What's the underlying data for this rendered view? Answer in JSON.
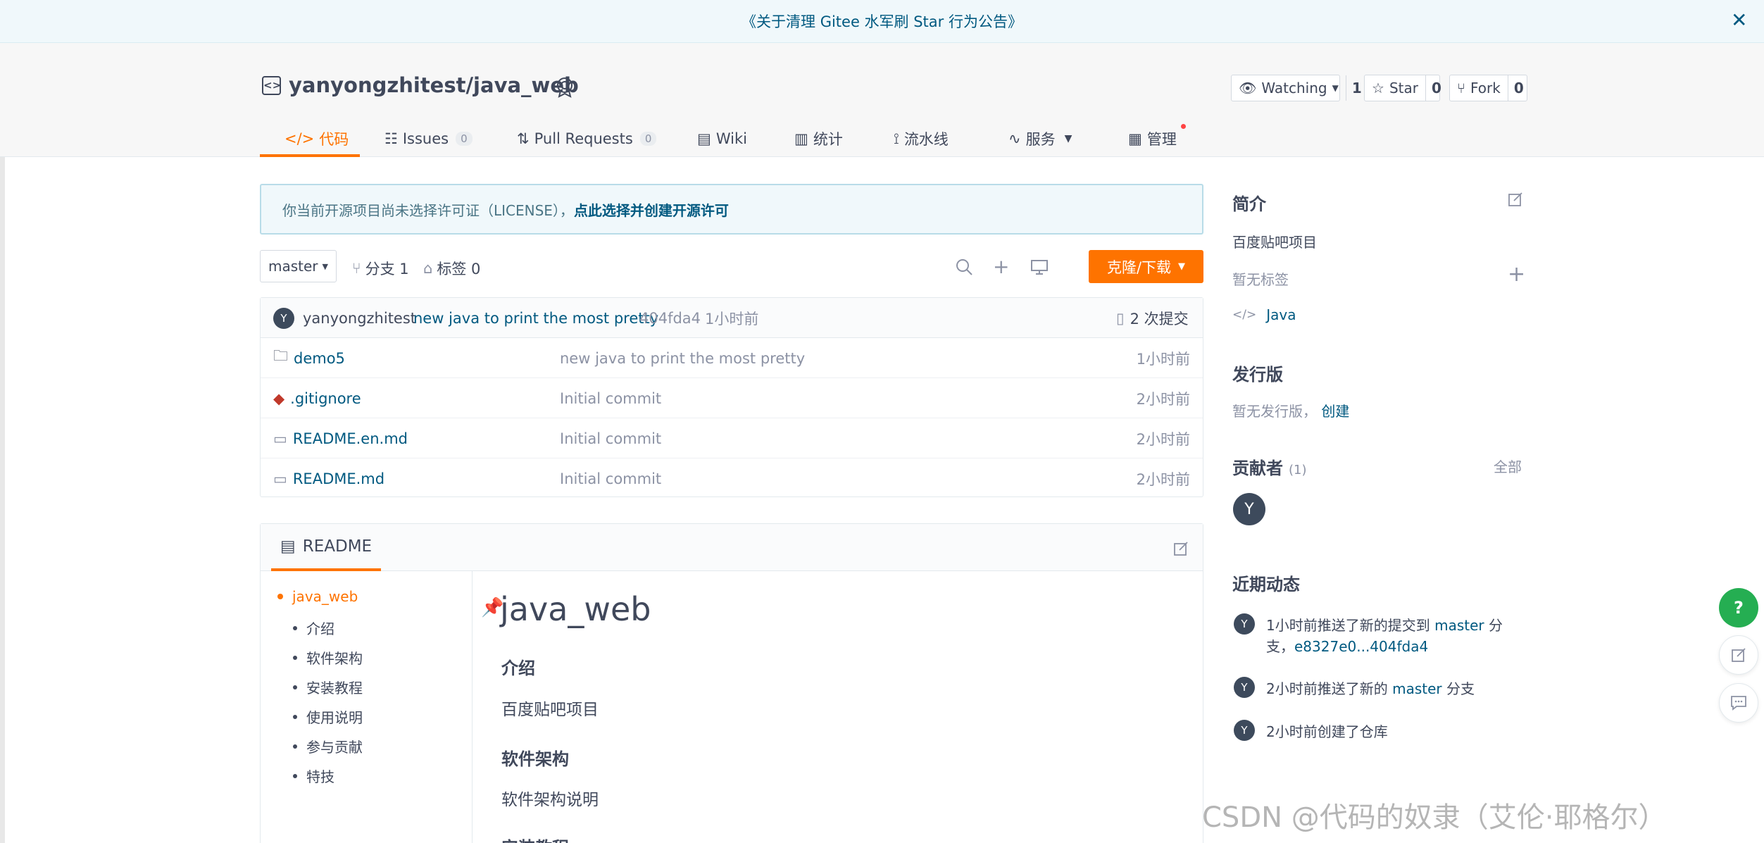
{
  "banner": {
    "text": "《关于清理 Gitee 水军刷 Star 行为公告》",
    "close": "✕"
  },
  "repo": {
    "title": "yanyongzhitest/java_web",
    "watch_label": "Watching",
    "watch_count": "1",
    "star_label": "Star",
    "star_count": "0",
    "fork_label": "Fork",
    "fork_count": "0"
  },
  "tabs": [
    {
      "label": "代码",
      "active": true
    },
    {
      "label": "Issues",
      "count": "0"
    },
    {
      "label": "Pull Requests",
      "count": "0"
    },
    {
      "label": "Wiki"
    },
    {
      "label": "统计"
    },
    {
      "label": "流水线"
    },
    {
      "label": "服务"
    },
    {
      "label": "管理"
    }
  ],
  "license": {
    "text": "你当前开源项目尚未选择许可证（LICENSE），",
    "link": "点此选择并创建开源许可"
  },
  "toolbar": {
    "branch": "master",
    "branches": "分支 1",
    "tags": "标签 0",
    "clone": "克隆/下载"
  },
  "commit": {
    "avatar": "Y",
    "author": "yanyongzhitest",
    "message": "new java to print the most pretty",
    "hash": "404fda4",
    "time": "1小时前",
    "count": "2 次提交"
  },
  "files": [
    {
      "name": "demo5",
      "type": "folder",
      "message": "new java to print the most pretty",
      "time": "1小时前"
    },
    {
      "name": ".gitignore",
      "type": "git",
      "message": "Initial commit",
      "time": "2小时前"
    },
    {
      "name": "README.en.md",
      "type": "doc",
      "message": "Initial commit",
      "time": "2小时前"
    },
    {
      "name": "README.md",
      "type": "doc",
      "message": "Initial commit",
      "time": "2小时前"
    }
  ],
  "readme": {
    "tab": "README",
    "toc": [
      "java_web",
      "介绍",
      "软件架构",
      "安装教程",
      "使用说明",
      "参与贡献",
      "特技"
    ],
    "h1": "java_web",
    "intro_h": "介绍",
    "intro_p": "百度贴吧项目",
    "arch_h": "软件架构",
    "arch_p": "软件架构说明",
    "install_h": "安装教程"
  },
  "sidebar": {
    "intro_title": "简介",
    "intro_text": "百度贴吧项目",
    "no_tags": "暂无标签",
    "language": "Java",
    "release_title": "发行版",
    "no_release": "暂无发行版，",
    "create": "创建",
    "contrib_title": "贡献者",
    "contrib_count": "(1)",
    "all": "全部",
    "contrib_avatar": "Y",
    "activity_title": "近期动态",
    "activities": [
      {
        "pre": "1小时前推送了新的提交到 ",
        "branch": "master",
        "post": " 分",
        "line2_pre": "支，",
        "line2_link": "e8327e0...404fda4"
      },
      {
        "pre": "2小时前推送了新的 ",
        "branch": "master",
        "post": " 分支"
      },
      {
        "pre": "2小时前创建了仓库"
      }
    ]
  },
  "fab": {
    "help": "?"
  },
  "watermark": "CSDN @代码的奴隶（艾伦·耶格尔）",
  "colors": {
    "accent": "#fe7300",
    "link": "#005980",
    "success": "#25ae52"
  }
}
